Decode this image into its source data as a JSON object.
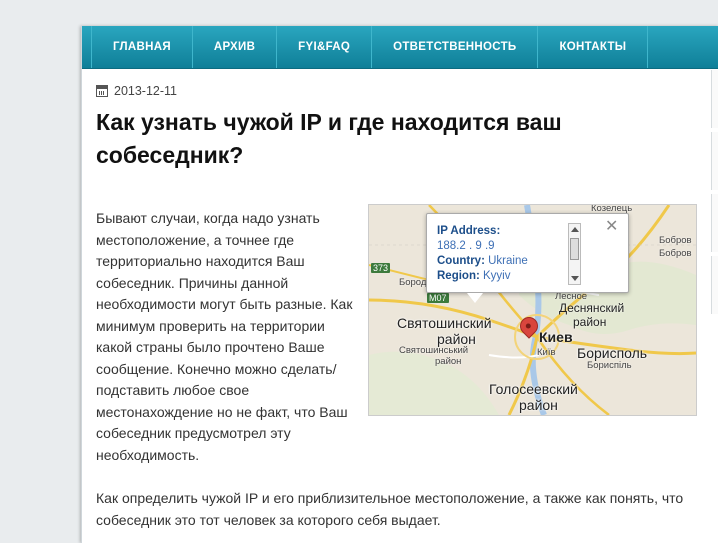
{
  "nav": {
    "items": [
      {
        "label": "ГЛАВНАЯ"
      },
      {
        "label": "АРХИВ"
      },
      {
        "label": "FYI&FAQ"
      },
      {
        "label": "ОТВЕТСТВЕННОСТЬ"
      },
      {
        "label": "КОНТАКТЫ"
      }
    ]
  },
  "post": {
    "date": "2013-12-11",
    "title": "Как узнать чужой IP и где находится ваш собеседник?",
    "paragraph1": "Бывают случаи, когда надо узнать местоположение, а точнее где территориально находится Ваш собеседник. Причины данной необходимости могут быть разные. Как минимум проверить на территории какой страны было прочтено Ваше сообщение. Конечно можно сделать/подставить любое свое местонахождение но не факт, что Ваш собеседник предусмотрел эту необходимость.",
    "paragraph2": "Как определить чужой IP и его приблизительное местоположение, а также как понять, что собеседник это тот человек за которого себя выдает."
  },
  "map": {
    "popup": {
      "ip_label": "IP Address:",
      "ip_value": "188.2 . 9 .9",
      "country_label": "Country:",
      "country_value": "Ukraine",
      "region_label": "Region:",
      "region_value": "Kyyiv"
    },
    "labels": {
      "kozelets": "Козелець",
      "bobrov1": "Бобров",
      "bobrov2": "Бобров",
      "borodyanka": "Бородянка",
      "lesnoye": "Лесное",
      "desnyansky": "Деснянский",
      "rayon1": "район",
      "svyatoshinsky": "Святошинский",
      "rayon2": "район",
      "kiev": "Киев",
      "kiyiv": "Київ",
      "svyatoshynsky_ua": "Святошинський",
      "rayon_ua": "район",
      "boryspil": "Борисполь",
      "boryspil_ua": "Бориспіль",
      "goloseevsky": "Голосеевский",
      "rayon3": "район",
      "road_m07": "M07",
      "road_373": "373"
    }
  }
}
